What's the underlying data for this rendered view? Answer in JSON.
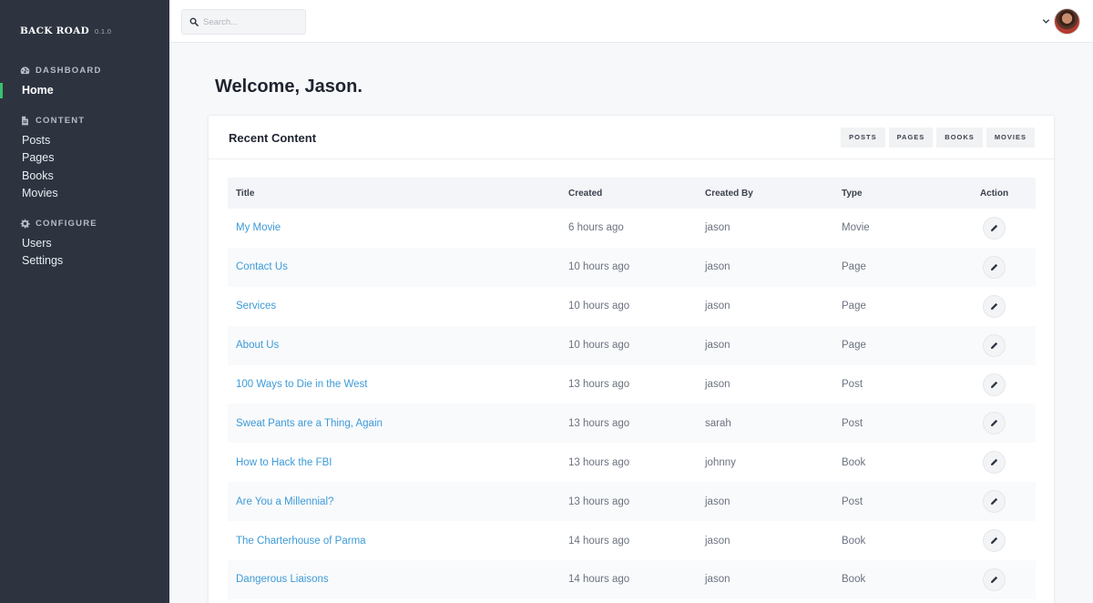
{
  "sidebar": {
    "brand": "BACK ROAD",
    "version": "0.1.0",
    "sections": [
      {
        "heading": "DASHBOARD",
        "icon": "dashboard-icon",
        "items": [
          {
            "label": "Home",
            "active": true
          }
        ]
      },
      {
        "heading": "CONTENT",
        "icon": "document-icon",
        "items": [
          {
            "label": "Posts"
          },
          {
            "label": "Pages"
          },
          {
            "label": "Books"
          },
          {
            "label": "Movies"
          }
        ]
      },
      {
        "heading": "CONFIGURE",
        "icon": "gear-icon",
        "items": [
          {
            "label": "Users"
          },
          {
            "label": "Settings"
          }
        ]
      }
    ]
  },
  "topbar": {
    "search_placeholder": "Search...",
    "search_icon": "search-icon",
    "user_menu_icon": "chevron-down-icon"
  },
  "main": {
    "title": "Welcome, Jason.",
    "card": {
      "title": "Recent Content",
      "filters": [
        "POSTS",
        "PAGES",
        "BOOKS",
        "MOVIES"
      ],
      "columns": [
        "Title",
        "Created",
        "Created By",
        "Type",
        "Action"
      ],
      "rows": [
        {
          "title": "My Movie",
          "created": "6 hours ago",
          "created_by": "jason",
          "type": "Movie"
        },
        {
          "title": "Contact Us",
          "created": "10 hours ago",
          "created_by": "jason",
          "type": "Page"
        },
        {
          "title": "Services",
          "created": "10 hours ago",
          "created_by": "jason",
          "type": "Page"
        },
        {
          "title": "About Us",
          "created": "10 hours ago",
          "created_by": "jason",
          "type": "Page"
        },
        {
          "title": "100 Ways to Die in the West",
          "created": "13 hours ago",
          "created_by": "jason",
          "type": "Post"
        },
        {
          "title": "Sweat Pants are a Thing, Again",
          "created": "13 hours ago",
          "created_by": "sarah",
          "type": "Post"
        },
        {
          "title": "How to Hack the FBI",
          "created": "13 hours ago",
          "created_by": "johnny",
          "type": "Book"
        },
        {
          "title": "Are You a Millennial?",
          "created": "13 hours ago",
          "created_by": "jason",
          "type": "Post"
        },
        {
          "title": "The Charterhouse of Parma",
          "created": "14 hours ago",
          "created_by": "jason",
          "type": "Book"
        },
        {
          "title": "Dangerous Liaisons",
          "created": "14 hours ago",
          "created_by": "jason",
          "type": "Book"
        }
      ]
    }
  },
  "colors": {
    "sidebar_bg": "#2d3440",
    "active_accent": "#38c172",
    "link": "#3d9ad8"
  }
}
